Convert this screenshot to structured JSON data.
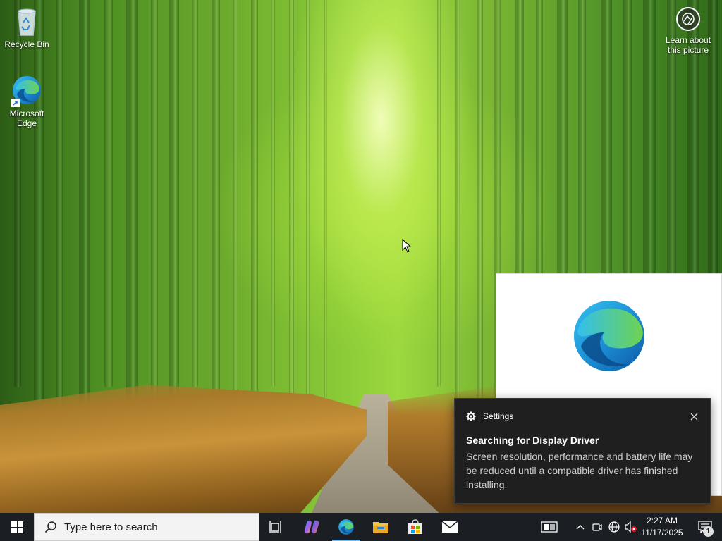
{
  "desktop": {
    "icons": [
      {
        "label": "Recycle Bin",
        "icon": "recycle-bin-icon"
      },
      {
        "label": "Microsoft Edge",
        "icon": "edge-icon"
      }
    ],
    "learn_about": {
      "label": "Learn about this picture",
      "icon": "camera-aperture-icon"
    }
  },
  "splash": {
    "app_icon": "edge-logo"
  },
  "toast": {
    "app_name": "Settings",
    "app_icon": "gear-icon",
    "title": "Searching for Display Driver",
    "body": "Screen resolution, performance and battery life may be reduced until a compatible driver has finished installing.",
    "close_icon": "close-icon"
  },
  "taskbar": {
    "search_placeholder": "Type here to search",
    "pinned": [
      {
        "name": "Task View",
        "icon": "task-view-icon"
      },
      {
        "name": "Copilot",
        "icon": "copilot-icon"
      },
      {
        "name": "Microsoft Edge",
        "icon": "edge-icon",
        "active": true
      },
      {
        "name": "File Explorer",
        "icon": "folder-icon"
      },
      {
        "name": "Microsoft Store",
        "icon": "store-icon"
      },
      {
        "name": "Mail",
        "icon": "mail-icon"
      }
    ],
    "tray": [
      "news-icon",
      "chevron-up-icon",
      "meet-now-icon",
      "network-icon",
      "volume-muted-icon"
    ],
    "time": "2:27 AM",
    "date": "11/17/2025",
    "notification_count": "1"
  },
  "colors": {
    "accent": "#76b9ed",
    "toast_bg": "#1f1f1f",
    "taskbar_bg": "#1b1e23"
  }
}
